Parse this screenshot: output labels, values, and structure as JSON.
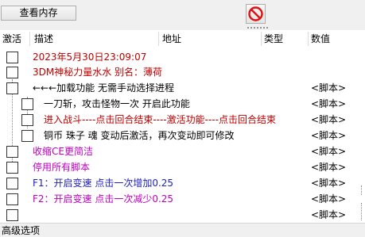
{
  "toolbar": {
    "view_memory_label": "查看内存",
    "clear_icon": "no-entry-icon"
  },
  "table": {
    "columns": {
      "active": "激活",
      "description": "描述",
      "address": "地址",
      "type": "类型",
      "value": "数值"
    },
    "rows": [
      {
        "description": "2023年5月30日23:09:07",
        "value": "",
        "color": "#c00000"
      },
      {
        "description": "3DM神秘力量水水  别名：薄荷",
        "value": "",
        "color": "#c00000"
      },
      {
        "description": "←←←加载功能 无需手动选择进程",
        "value": "<脚本>",
        "color": "#000000"
      },
      {
        "description": "一刀斩，攻击怪物一次 开启此功能",
        "value": "<脚本>",
        "color": "#000000"
      },
      {
        "description": "进入战斗----点击回合结束----激活功能----点击回合结束",
        "value": "<脚本>",
        "color": "#c00000"
      },
      {
        "description": "铜币 珠子  魂  变动后激活，再次变动即可修改",
        "value": "<脚本>",
        "color": "#000000"
      },
      {
        "description": "收缩CE更简洁",
        "value": "<脚本>",
        "color": "#c000c0"
      },
      {
        "description": "停用所有脚本",
        "value": "<脚本>",
        "color": "#c000c0"
      },
      {
        "description": "F1：开启变速 点击一次增加0.25",
        "value": "<脚本>",
        "color": "#2020c0"
      },
      {
        "description": "F2：开启变速 点击一次减少0.25",
        "value": "<脚本>",
        "color": "#c000c0"
      },
      {
        "description": "",
        "value": "<脚本>",
        "color": "#c000c0"
      }
    ]
  },
  "status": {
    "advanced_options": "高级选项"
  }
}
